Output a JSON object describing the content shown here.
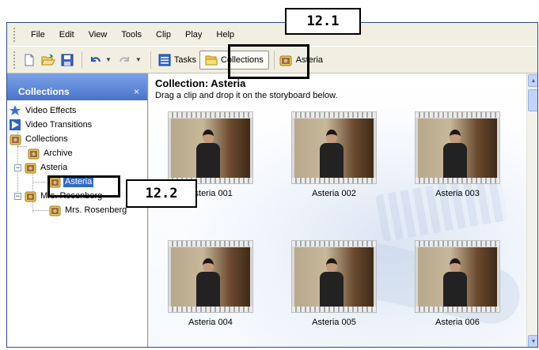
{
  "menubar": {
    "items": [
      "File",
      "Edit",
      "View",
      "Tools",
      "Clip",
      "Play",
      "Help"
    ]
  },
  "toolbar": {
    "tasks_label": "Tasks",
    "collections_label": "Collections",
    "current_collection": "Asteria",
    "icons": [
      "new-icon",
      "open-icon",
      "save-icon",
      "undo-icon",
      "redo-icon",
      "tasks-icon",
      "collections-folder-icon",
      "collection-icon"
    ]
  },
  "left_pane": {
    "header": "Collections",
    "close": "×",
    "tree": {
      "video_effects": "Video Effects",
      "video_transitions": "Video Transitions",
      "collections": "Collections",
      "archive": "Archive",
      "asteria_parent": "Asteria",
      "asteria_child": "Asteria",
      "mrs_rosenberg_parent": "Mrs. Rosenberg",
      "mrs_rosenberg_child": "Mrs. Rosenberg"
    }
  },
  "content": {
    "title": "Collection: Asteria",
    "subtitle": "Drag a clip and drop it on the storyboard below.",
    "clips": [
      "Asteria 001",
      "Asteria 002",
      "Asteria 003",
      "Asteria 004",
      "Asteria 005",
      "Asteria 006"
    ]
  },
  "callouts": {
    "collections_button": "12.1",
    "asteria_tree_item": "12.2"
  },
  "colors": {
    "selection": "#316ac5",
    "pane_header": "#4a74c9",
    "toolbar_bg": "#f1efe2"
  }
}
